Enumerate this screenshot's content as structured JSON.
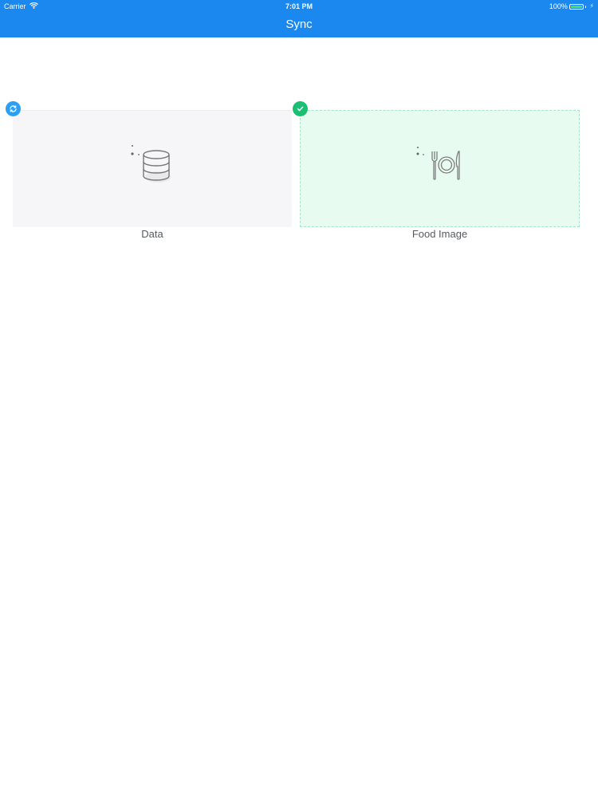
{
  "status_bar": {
    "carrier": "Carrier",
    "time": "7:01 PM",
    "battery": "100%"
  },
  "nav": {
    "title": "Sync"
  },
  "cards": [
    {
      "label": "Data",
      "icon": "database-icon",
      "badge": "sync-icon",
      "state": "syncing",
      "badge_color": "#2a9ff3"
    },
    {
      "label": "Food Image",
      "icon": "plate-cutlery-icon",
      "badge": "check-icon",
      "state": "done",
      "badge_color": "#1bbf73"
    }
  ],
  "colors": {
    "nav_bar": "#1a88ee",
    "card_default": "#f6f5f7",
    "card_success": "#e8fbf1"
  }
}
